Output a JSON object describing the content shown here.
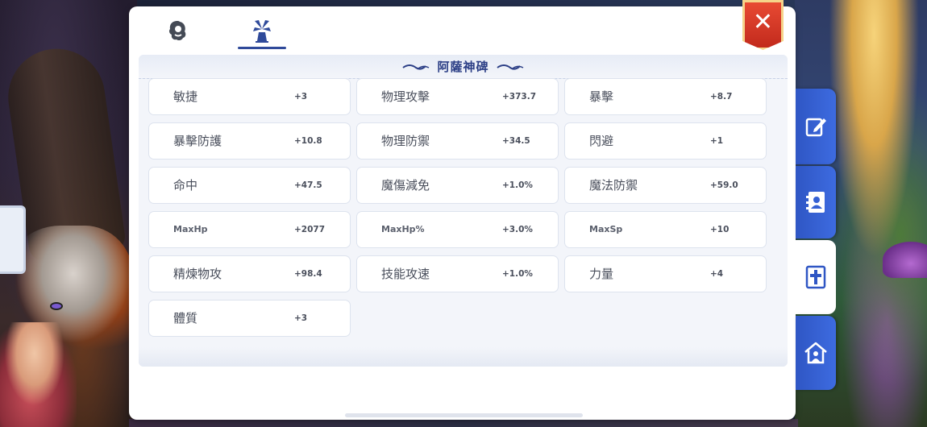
{
  "colors": {
    "accent": "#2f4a9a",
    "title": "#2c3f86",
    "close": "#d9351f",
    "side_tab": "#3561d4"
  },
  "tabs": [
    {
      "icon": "profile-icon",
      "active": false
    },
    {
      "icon": "windmill-monument-icon",
      "active": true
    }
  ],
  "section": {
    "title": "阿薩神碑"
  },
  "stats": [
    {
      "name": "敏捷",
      "value": "+3"
    },
    {
      "name": "物理攻擊",
      "value": "+373.7"
    },
    {
      "name": "暴擊",
      "value": "+8.7"
    },
    {
      "name": "暴擊防護",
      "value": "+10.8"
    },
    {
      "name": "物理防禦",
      "value": "+34.5"
    },
    {
      "name": "閃避",
      "value": "+1"
    },
    {
      "name": "命中",
      "value": "+47.5"
    },
    {
      "name": "魔傷減免",
      "value": "+1.0%"
    },
    {
      "name": "魔法防禦",
      "value": "+59.0"
    },
    {
      "name": "MaxHp",
      "value": "+2077"
    },
    {
      "name": "MaxHp%",
      "value": "+3.0%"
    },
    {
      "name": "MaxSp",
      "value": "+10"
    },
    {
      "name": "精煉物攻",
      "value": "+98.4"
    },
    {
      "name": "技能攻速",
      "value": "+1.0%"
    },
    {
      "name": "力量",
      "value": "+4"
    },
    {
      "name": "體質",
      "value": "+3"
    }
  ],
  "side_tabs": [
    {
      "icon": "edit-icon",
      "active": false
    },
    {
      "icon": "contact-book-icon",
      "active": false
    },
    {
      "icon": "cross-emblem-icon",
      "active": true
    },
    {
      "icon": "guild-house-icon",
      "active": false
    }
  ]
}
